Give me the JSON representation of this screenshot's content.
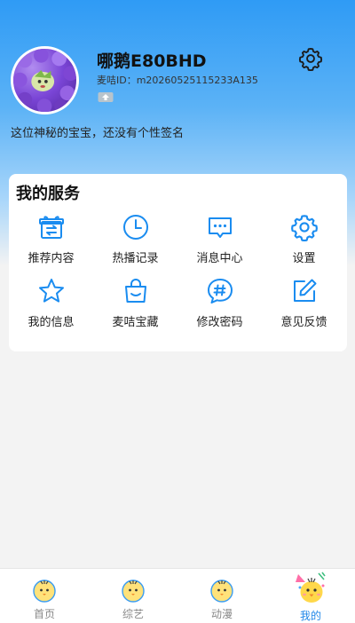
{
  "profile": {
    "username": "哪鹅E80BHD",
    "user_id": "麦咭ID：m20260525115233A135",
    "signature": "这位神秘的宝宝，还没有个性签名"
  },
  "services": {
    "title": "我的服务",
    "items": [
      {
        "label": "推荐内容",
        "icon": "gift-swap-icon"
      },
      {
        "label": "热播记录",
        "icon": "clock-icon"
      },
      {
        "label": "消息中心",
        "icon": "chat-bubble-icon"
      },
      {
        "label": "设置",
        "icon": "gear-icon"
      },
      {
        "label": "我的信息",
        "icon": "star-icon"
      },
      {
        "label": "麦咭宝藏",
        "icon": "bag-icon"
      },
      {
        "label": "修改密码",
        "icon": "hash-bubble-icon"
      },
      {
        "label": "意见反馈",
        "icon": "edit-icon"
      }
    ]
  },
  "tabbar": {
    "tabs": [
      {
        "label": "首页",
        "icon": "chick-icon",
        "active": false
      },
      {
        "label": "综艺",
        "icon": "chick-icon",
        "active": false
      },
      {
        "label": "动漫",
        "icon": "chick-icon",
        "active": false
      },
      {
        "label": "我的",
        "icon": "chick-party-icon",
        "active": true
      }
    ]
  },
  "colors": {
    "accent": "#1f86e8",
    "header_gradient_top": "#2f9bf5",
    "icon_blue": "#1a8cf0"
  }
}
